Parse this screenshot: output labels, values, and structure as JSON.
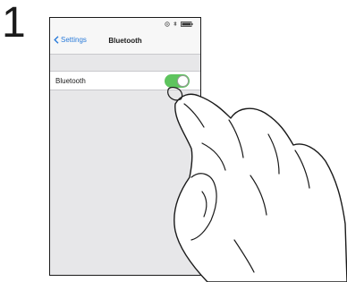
{
  "step": {
    "number": "1"
  },
  "navbar": {
    "back_label": "Settings",
    "title": "Bluetooth"
  },
  "settings": {
    "rows": [
      {
        "label": "Bluetooth",
        "toggle_on": true
      }
    ]
  },
  "colors": {
    "accent": "#2a7bd9",
    "toggle_on": "#5ec45e",
    "background": "#e7e7e9"
  },
  "icons": {
    "status": [
      "location-icon",
      "bluetooth-icon",
      "battery-icon"
    ],
    "back": "chevron-left-icon",
    "illustration": "hand-pointer-illustration"
  }
}
